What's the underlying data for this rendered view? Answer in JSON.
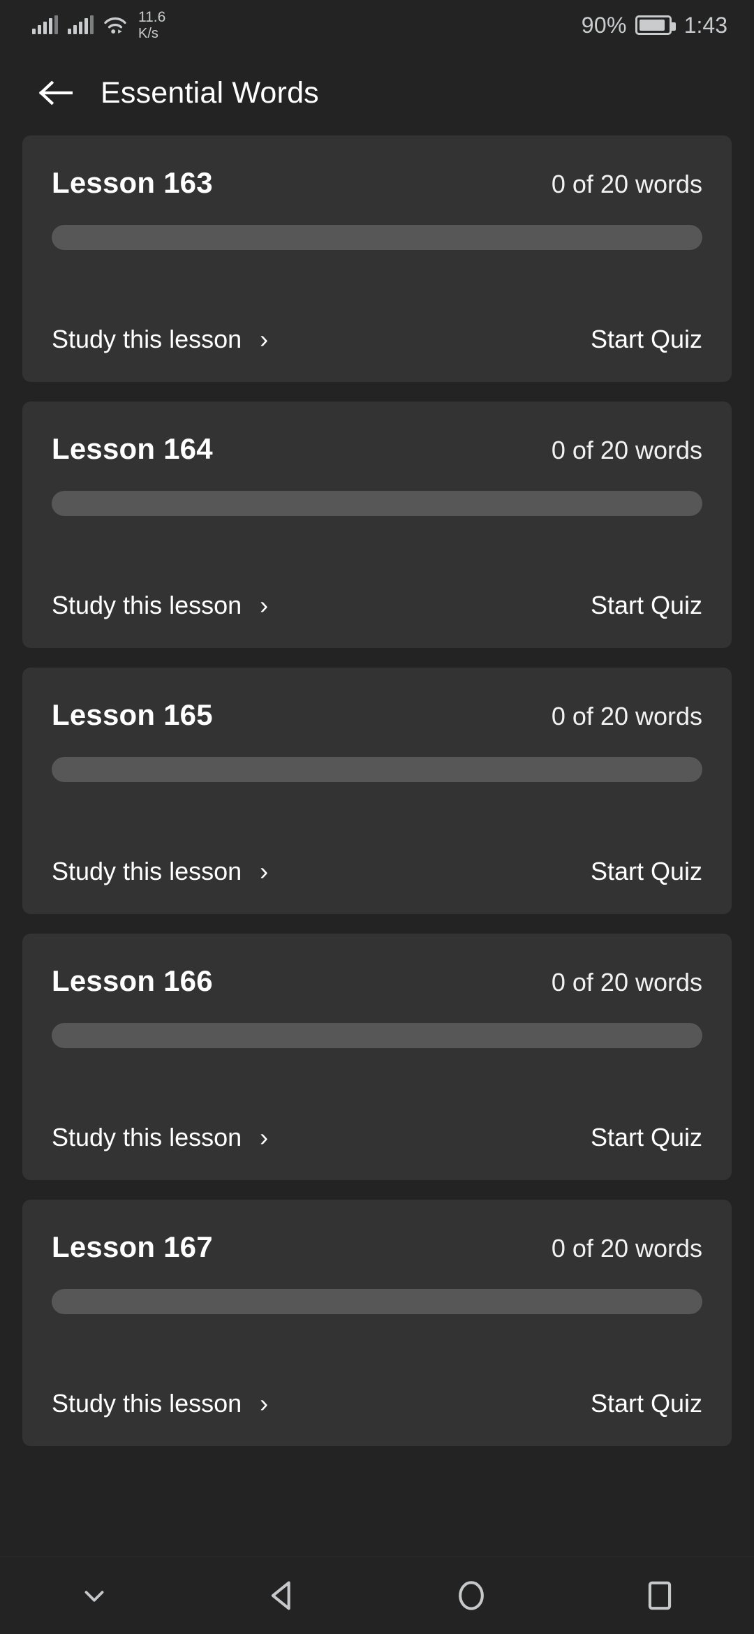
{
  "status_bar": {
    "signal_icon_1": "cellular-signal-icon",
    "signal_icon_2": "cellular-signal-icon",
    "wifi_icon": "wifi-icon",
    "network_speed_value": "11.6",
    "network_speed_unit": "K/s",
    "battery_percent": "90%",
    "battery_level": 90,
    "battery_icon": "battery-icon",
    "time": "1:43"
  },
  "header": {
    "back_icon": "back-arrow-icon",
    "title": "Essential Words"
  },
  "colors": {
    "page_background": "#232323",
    "card_background": "#333333",
    "progress_track": "#575757",
    "text_primary": "#ffffff",
    "status_icon": "#c9cbcc"
  },
  "lessons": [
    {
      "title": "Lesson 163",
      "word_count": "0 of 20 words",
      "progress_percent": 0,
      "study_label": "Study this lesson",
      "chevron": "›",
      "quiz_label": "Start Quiz"
    },
    {
      "title": "Lesson 164",
      "word_count": "0 of 20 words",
      "progress_percent": 0,
      "study_label": "Study this lesson",
      "chevron": "›",
      "quiz_label": "Start Quiz"
    },
    {
      "title": "Lesson 165",
      "word_count": "0 of 20 words",
      "progress_percent": 0,
      "study_label": "Study this lesson",
      "chevron": "›",
      "quiz_label": "Start Quiz"
    },
    {
      "title": "Lesson 166",
      "word_count": "0 of 20 words",
      "progress_percent": 0,
      "study_label": "Study this lesson",
      "chevron": "›",
      "quiz_label": "Start Quiz"
    },
    {
      "title": "Lesson 167",
      "word_count": "0 of 20 words",
      "progress_percent": 0,
      "study_label": "Study this lesson",
      "chevron": "›",
      "quiz_label": "Start Quiz"
    }
  ],
  "nav_bar": {
    "items": [
      {
        "icon": "chevron-down-icon"
      },
      {
        "icon": "back-triangle-icon"
      },
      {
        "icon": "home-circle-icon"
      },
      {
        "icon": "recents-square-icon"
      }
    ]
  }
}
